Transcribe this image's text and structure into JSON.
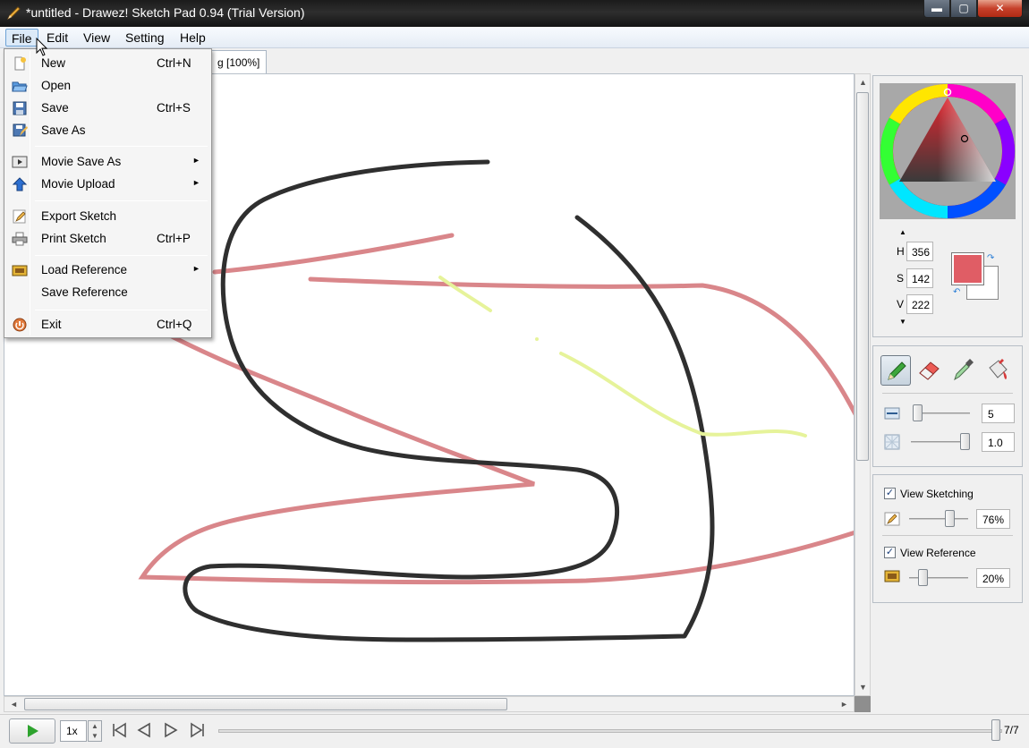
{
  "window": {
    "title": "*untitled - Drawez! Sketch Pad 0.94 (Trial Version)",
    "controls": {
      "minimize": "▬",
      "maximize": "▢",
      "close": "✕"
    }
  },
  "menubar": {
    "items": [
      {
        "label": "File"
      },
      {
        "label": "Edit"
      },
      {
        "label": "View"
      },
      {
        "label": "Setting"
      },
      {
        "label": "Help"
      }
    ]
  },
  "tab": {
    "label": "g [100%]"
  },
  "file_menu": {
    "items": [
      {
        "label": "New",
        "shortcut": "Ctrl+N",
        "icon": "new-file-icon"
      },
      {
        "label": "Open",
        "shortcut": "",
        "icon": "open-folder-icon"
      },
      {
        "label": "Save",
        "shortcut": "Ctrl+S",
        "icon": "save-disk-icon"
      },
      {
        "label": "Save As",
        "shortcut": "",
        "icon": "save-as-icon"
      },
      {
        "label": "Movie Save As",
        "shortcut": "",
        "icon": "movie-icon",
        "submenu": "►"
      },
      {
        "label": "Movie Upload",
        "shortcut": "",
        "icon": "upload-arrow-icon",
        "submenu": "►"
      },
      {
        "label": "Export Sketch",
        "shortcut": "",
        "icon": "export-sketch-icon"
      },
      {
        "label": "Print Sketch",
        "shortcut": "Ctrl+P",
        "icon": "printer-icon"
      },
      {
        "label": "Load Reference",
        "shortcut": "",
        "icon": "load-reference-icon",
        "submenu": "►"
      },
      {
        "label": "Save Reference",
        "shortcut": "",
        "icon": ""
      },
      {
        "label": "Exit",
        "shortcut": "Ctrl+Q",
        "icon": "exit-icon"
      }
    ]
  },
  "color_panel": {
    "h_label": "H",
    "h_value": "356",
    "s_label": "S",
    "s_value": "142",
    "v_label": "V",
    "v_value": "222",
    "foreground_color": "#e05d65",
    "background_color": "#ffffff"
  },
  "tools": {
    "items": [
      "pencil-tool-icon",
      "eraser-tool-icon",
      "eyedropper-tool-icon",
      "fill-bucket-tool-icon"
    ],
    "selected": "pencil-tool-icon",
    "brush_size": "5",
    "opacity": "1.0"
  },
  "view_panel": {
    "view_sketching_label": "View Sketching",
    "view_sketching_checked": true,
    "sketching_opacity": "76%",
    "view_reference_label": "View Reference",
    "view_reference_checked": true,
    "reference_opacity": "20%"
  },
  "playback": {
    "speed": "1x",
    "frame_counter": "7/7"
  },
  "stroke_colors": {
    "black": "#2f2f2f",
    "pink": "#d9868a",
    "yellow": "#e6f39a"
  }
}
